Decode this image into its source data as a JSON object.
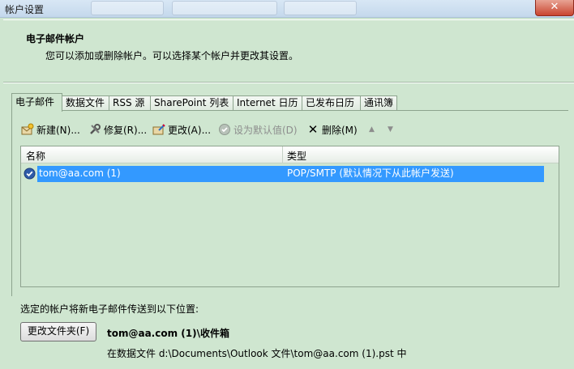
{
  "window": {
    "title": "帐户设置",
    "close_glyph": "✕"
  },
  "header": {
    "title": "电子邮件帐户",
    "description": "您可以添加或删除帐户。可以选择某个帐户并更改其设置。"
  },
  "tabs": [
    {
      "label": "电子邮件",
      "active": true
    },
    {
      "label": "数据文件"
    },
    {
      "label": "RSS 源"
    },
    {
      "label": "SharePoint 列表"
    },
    {
      "label": "Internet 日历"
    },
    {
      "label": "已发布日历"
    },
    {
      "label": "通讯簿"
    }
  ],
  "toolbar": {
    "new_label": "新建(N)...",
    "repair_label": "修复(R)...",
    "change_label": "更改(A)...",
    "set_default_label": "设为默认值(D)",
    "remove_label": "删除(M)",
    "remove_glyph": "✕",
    "up_glyph": "▲",
    "down_glyph": "▼"
  },
  "list": {
    "columns": {
      "name": "名称",
      "type": "类型"
    },
    "rows": [
      {
        "name": "tom@aa.com (1)",
        "type": "POP/SMTP (默认情况下从此帐户发送)",
        "default": true
      }
    ]
  },
  "delivery": {
    "label": "选定的帐户将新电子邮件传送到以下位置:",
    "change_folder_button": "更改文件夹(F)",
    "folder": "tom@aa.com (1)\\收件箱",
    "data_file": "在数据文件 d:\\Documents\\Outlook 文件\\tom@aa.com (1).pst 中"
  },
  "colors": {
    "background": "#cfe6d0",
    "selection": "#3399ff",
    "close_button": "#c9452f"
  },
  "icons": {
    "new": "new-account-icon",
    "repair": "repair-tools-icon",
    "change": "change-account-icon",
    "set_default": "set-default-check-icon",
    "remove": "remove-x-icon",
    "up": "move-up-arrow-icon",
    "down": "move-down-arrow-icon",
    "default_account": "default-account-check-icon"
  }
}
